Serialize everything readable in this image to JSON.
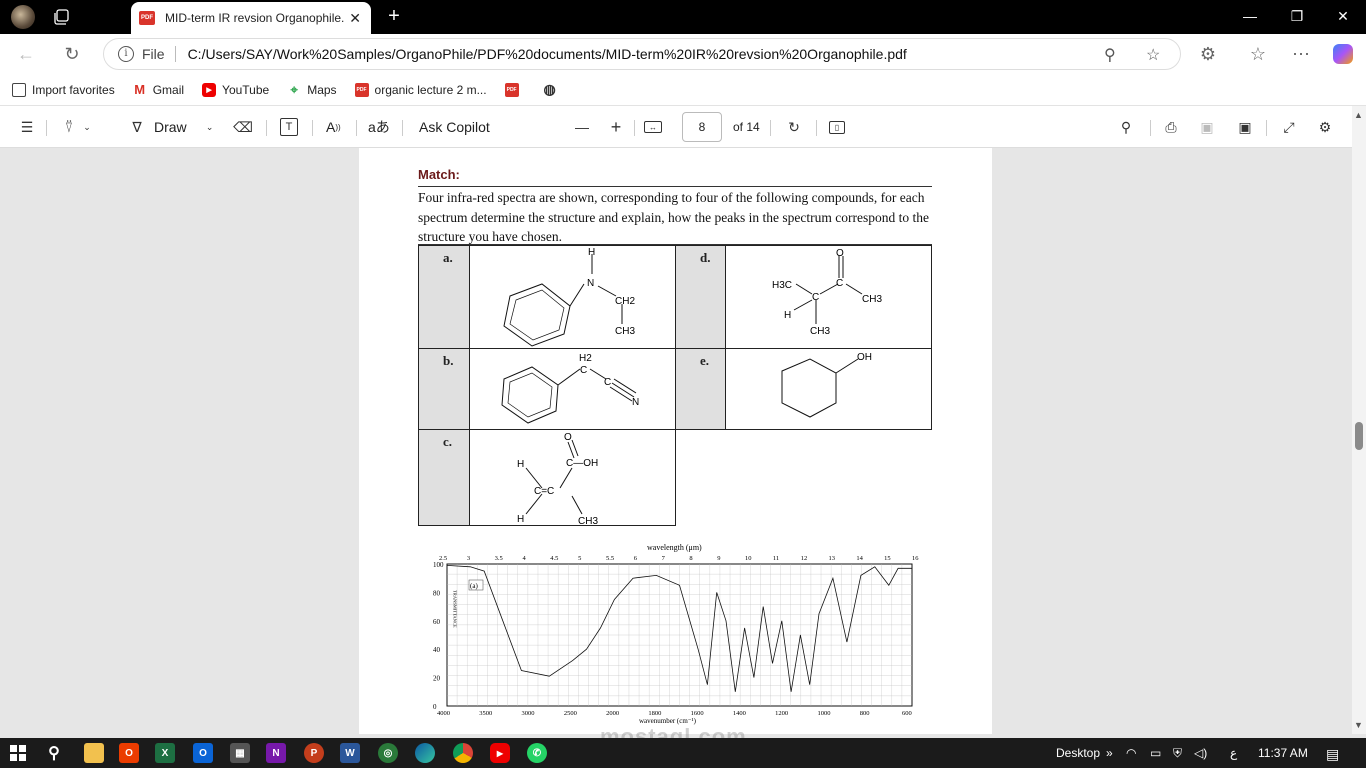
{
  "browser": {
    "tab_title": "MID-term IR revsion Organophile.pdf",
    "pdf_badge": "PDF",
    "file_label": "File",
    "url": "C:/Users/SAY/Work%20Samples/OrganoPhile/PDF%20documents/MID-term%20IR%20revsion%20Organophile.pdf"
  },
  "favorites": [
    {
      "label": "Import favorites",
      "icon": "import-icon"
    },
    {
      "label": "Gmail",
      "icon": "gmail-icon"
    },
    {
      "label": "YouTube",
      "icon": "youtube-icon"
    },
    {
      "label": "Maps",
      "icon": "maps-icon"
    },
    {
      "label": "organic lecture 2 m...",
      "icon": "pdf-icon"
    }
  ],
  "pdf_toolbar": {
    "draw_label": "Draw",
    "copilot_label": "Ask Copilot",
    "current_page": "8",
    "total_pages": "of 14",
    "aa_label": "A",
    "translate_label": "aあ"
  },
  "document": {
    "match_title": "Match:",
    "instructions": "Four infra-red spectra are shown, corresponding to four of the following compounds, for each spectrum determine the structure and explain, how the peaks in the spectrum correspond to the structure you have chosen.",
    "labels": {
      "a": "a.",
      "b": "b.",
      "c": "c.",
      "d": "d.",
      "e": "e."
    },
    "mol_text": {
      "a_h": "H",
      "a_n": "N",
      "a_ch2": "CH2",
      "a_ch3": "CH3",
      "b_h2": "H2",
      "b_c": "C",
      "b_cc": "C",
      "b_n": "N",
      "c_o": "O",
      "c_oh": "C—OH",
      "c_h1": "H",
      "c_h2": "H",
      "c_ch3": "CH3",
      "c_c1": "C=C",
      "d_o": "O",
      "d_h3c": "H3C",
      "d_c1": "C",
      "d_c2": "C",
      "d_ch3a": "CH3",
      "d_h": "H",
      "d_ch3b": "CH3",
      "e_oh": "OH"
    },
    "spectrum": {
      "top_axis_title": "wavelength (μm)",
      "top_ticks": [
        "2.5",
        "3",
        "3.5",
        "4",
        "4.5",
        "5",
        "5.5",
        "6",
        "7",
        "8",
        "9",
        "10",
        "11",
        "12",
        "13",
        "14",
        "15",
        "16"
      ],
      "bottom_ticks": [
        "4000",
        "3500",
        "3000",
        "2500",
        "2000",
        "1800",
        "1600",
        "1400",
        "1200",
        "1000",
        "800",
        "600"
      ],
      "bottom_axis_title": "wavenumber (cm⁻¹)",
      "y_ticks": [
        "100",
        "80",
        "60",
        "40",
        "20",
        "0"
      ],
      "y_axis_title": "TRANSMITTANCE",
      "panel_label": "(a)"
    }
  },
  "taskbar": {
    "desktop_label": "Desktop",
    "time": "11:37 AM",
    "lang": "ع"
  },
  "watermark": "mostaql.com"
}
